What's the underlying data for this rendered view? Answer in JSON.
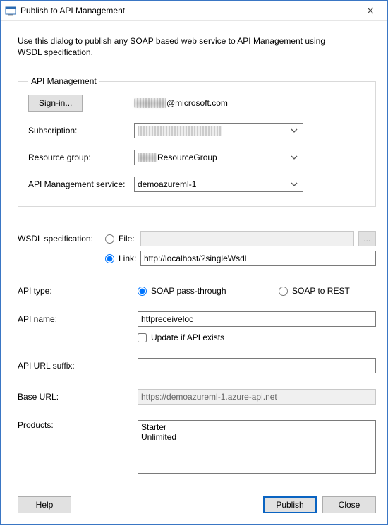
{
  "window": {
    "title": "Publish to API Management"
  },
  "intro": "Use this dialog to publish any SOAP based web service to API Management using WSDL specification.",
  "group": {
    "legend": "API Management",
    "signin_label": "Sign-in...",
    "account_suffix": "@microsoft.com",
    "subscription_label": "Subscription:",
    "subscription_value": "",
    "resource_group_label": "Resource group:",
    "resource_group_value": "ResourceGroup",
    "service_label": "API Management service:",
    "service_value": "demoazureml-1"
  },
  "wsdl": {
    "label": "WSDL specification:",
    "file_label": "File:",
    "link_label": "Link:",
    "file_value": "",
    "link_value": "http://localhost/?singleWsdl",
    "browse_label": "..."
  },
  "api_type": {
    "label": "API type:",
    "passthrough": "SOAP pass-through",
    "rest": "SOAP to REST"
  },
  "api_name": {
    "label": "API name:",
    "value": "httpreceiveloc",
    "update_label": "Update if API exists"
  },
  "suffix": {
    "label": "API URL suffix:",
    "value": ""
  },
  "base_url": {
    "label": "Base URL:",
    "value": "https://demoazureml-1.azure-api.net"
  },
  "products": {
    "label": "Products:",
    "items": [
      "Starter",
      "Unlimited"
    ]
  },
  "buttons": {
    "help": "Help",
    "publish": "Publish",
    "close": "Close"
  }
}
